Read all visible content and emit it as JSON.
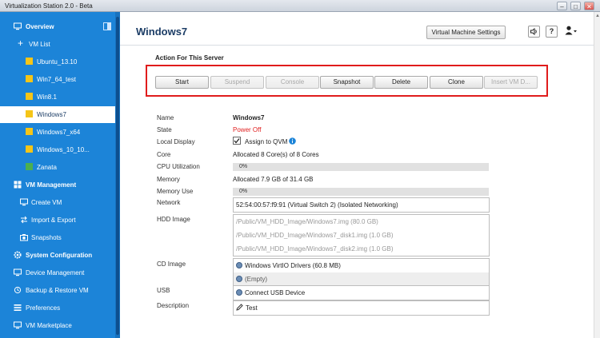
{
  "window": {
    "title": "Virtualization Station 2.0 - Beta",
    "minimize": "–",
    "maximize": "□",
    "close": "✕"
  },
  "sidebar": {
    "overview": "Overview",
    "vm_list": "VM List",
    "vms": [
      {
        "name": "Ubuntu_13.10",
        "status_color": "#f5c518"
      },
      {
        "name": "Win7_64_test",
        "status_color": "#f5c518"
      },
      {
        "name": "Win8.1",
        "status_color": "#f5c518"
      },
      {
        "name": "Windows7",
        "status_color": "#f5c518",
        "selected": true
      },
      {
        "name": "Windows7_x64",
        "status_color": "#f5c518"
      },
      {
        "name": "Windows_10_10...",
        "status_color": "#f5c518"
      },
      {
        "name": "Zanata",
        "status_color": "#4caf50"
      }
    ],
    "vm_management": "VM Management",
    "create_vm": "Create VM",
    "import_export": "Import & Export",
    "snapshots": "Snapshots",
    "system_configuration": "System Configuration",
    "device_management": "Device Management",
    "backup_restore": "Backup & Restore VM",
    "preferences": "Preferences",
    "vm_marketplace": "VM Marketplace"
  },
  "header": {
    "title": "Windows7",
    "settings_button": "Virtual Machine Settings",
    "help": "?"
  },
  "actions": {
    "section_title": "Action For This Server",
    "buttons": [
      {
        "label": "Start",
        "enabled": true
      },
      {
        "label": "Suspend",
        "enabled": false
      },
      {
        "label": "Console",
        "enabled": false
      },
      {
        "label": "Snapshot",
        "enabled": true
      },
      {
        "label": "Delete",
        "enabled": true
      },
      {
        "label": "Clone",
        "enabled": true
      },
      {
        "label": "Insert VM D...",
        "enabled": false
      }
    ]
  },
  "details": {
    "name_label": "Name",
    "name": "Windows7",
    "state_label": "State",
    "state": "Power Off",
    "state_color": "#e02020",
    "local_display_label": "Local Display",
    "local_display": "Assign to QVM",
    "local_display_checked": true,
    "core_label": "Core",
    "core": "Allocated 8 Core(s) of 8 Cores",
    "cpu_label": "CPU Utilization",
    "cpu": "0%",
    "cpu_fraction": 0.0,
    "memory_label": "Memory",
    "memory": "Allocated 7.9 GB of 31.4 GB",
    "memory_use_label": "Memory Use",
    "memory_use": "0%",
    "memory_use_fraction": 0.0,
    "network_label": "Network",
    "network": "52:54:00:57:f9:91 (Virtual Switch 2) (Isolated Networking)",
    "hdd_label": "HDD Image",
    "hdd": [
      "/Public/VM_HDD_Image/Windows7.img (80.0 GB)",
      "/Public/VM_HDD_Image/Windows7_disk1.img (1.0 GB)",
      "/Public/VM_HDD_Image/Windows7_disk2.img (1.0 GB)"
    ],
    "cd_label": "CD Image",
    "cd": [
      "Windows VirtIO Drivers (60.8 MB)",
      "(Empty)"
    ],
    "usb_label": "USB",
    "usb": "Connect USB Device",
    "description_label": "Description",
    "description": "Test"
  }
}
